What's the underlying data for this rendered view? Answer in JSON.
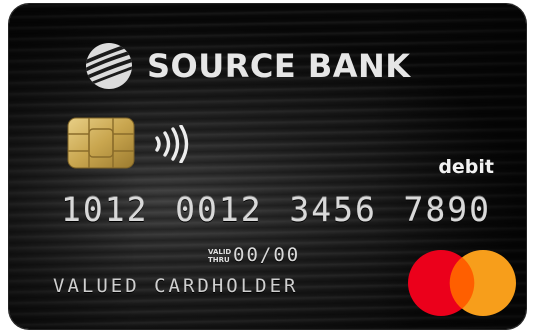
{
  "card": {
    "bank_name": "SOURCE BANK",
    "card_type": "debit",
    "number_groups": [
      "1012",
      "0012",
      "3456",
      "7890"
    ],
    "valid_thru_label_line1": "VALID",
    "valid_thru_label_line2": "THRU",
    "expiry": "00/00",
    "cardholder": "VALUED CARDHOLDER"
  },
  "icons": {
    "bank_logo": "swoosh-globe-icon",
    "chip": "emv-chip-icon",
    "contactless": "contactless-icon",
    "network": "mastercard-logo"
  },
  "colors": {
    "card_background": "#1b1b1b",
    "chip_gold": "#c9a64f",
    "mastercard_red": "#eb001b",
    "mastercard_yellow": "#f79e1b",
    "mastercard_overlap": "#ff5f00"
  }
}
